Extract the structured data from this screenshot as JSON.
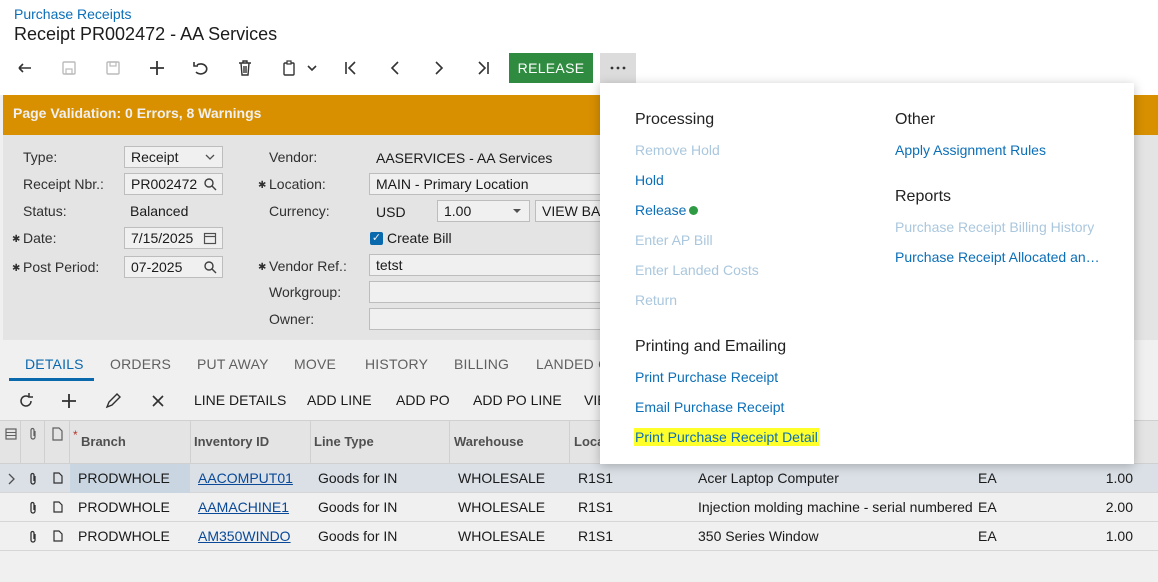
{
  "header": {
    "breadcrumb": "Purchase Receipts",
    "title": "Receipt PR002472 - AA Services"
  },
  "toolbar": {
    "release_label": "RELEASE",
    "more_label": "···"
  },
  "validation": {
    "text": "Page Validation: 0 Errors, 8 Warnings"
  },
  "form": {
    "type_label": "Type:",
    "type_value": "Receipt",
    "receipt_nbr_label": "Receipt Nbr.:",
    "receipt_nbr_value": "PR002472",
    "status_label": "Status:",
    "status_value": "Balanced",
    "date_label": "Date:",
    "date_value": "7/15/2025",
    "post_period_label": "Post Period:",
    "post_period_value": "07-2025",
    "vendor_label": "Vendor:",
    "vendor_value": "AASERVICES - AA Services",
    "location_label": "Location:",
    "location_value": "MAIN - Primary Location",
    "currency_label": "Currency:",
    "currency_value": "USD",
    "currency_rate": "1.00",
    "view_base_label": "VIEW BAS",
    "create_bill_label": "Create Bill",
    "vendor_ref_label": "Vendor Ref.:",
    "vendor_ref_value": "tetst",
    "workgroup_label": "Workgroup:",
    "owner_label": "Owner:"
  },
  "tabs": [
    "DETAILS",
    "ORDERS",
    "PUT AWAY",
    "MOVE",
    "HISTORY",
    "BILLING",
    "LANDED C"
  ],
  "grid_toolbar": [
    "LINE DETAILS",
    "ADD LINE",
    "ADD PO",
    "ADD PO LINE",
    "VIE"
  ],
  "grid": {
    "headers": [
      "Branch",
      "Inventory ID",
      "Line Type",
      "Warehouse",
      "Loca"
    ],
    "rows": [
      {
        "branch": "PRODWHOLE",
        "inventory_id": "AACOMPUT01",
        "line_type": "Goods for IN",
        "warehouse": "WHOLESALE",
        "location": "R1S1",
        "description": "Acer Laptop Computer",
        "uom": "EA",
        "qty": "1.00"
      },
      {
        "branch": "PRODWHOLE",
        "inventory_id": "AAMACHINE1",
        "line_type": "Goods for IN",
        "warehouse": "WHOLESALE",
        "location": "R1S1",
        "description": "Injection molding machine - serial numbered",
        "uom": "EA",
        "qty": "2.00"
      },
      {
        "branch": "PRODWHOLE",
        "inventory_id": "AM350WINDO",
        "line_type": "Goods for IN",
        "warehouse": "WHOLESALE",
        "location": "R1S1",
        "description": "350 Series Window",
        "uom": "EA",
        "qty": "1.00"
      }
    ]
  },
  "menu": {
    "processing": {
      "heading": "Processing",
      "items": [
        "Remove Hold",
        "Hold",
        "Release",
        "Enter AP Bill",
        "Enter Landed Costs",
        "Return"
      ]
    },
    "printing": {
      "heading": "Printing and Emailing",
      "items": [
        "Print Purchase Receipt",
        "Email Purchase Receipt",
        "Print Purchase Receipt Detail"
      ]
    },
    "other": {
      "heading": "Other",
      "items": [
        "Apply Assignment Rules"
      ]
    },
    "reports": {
      "heading": "Reports",
      "items": [
        "Purchase Receipt Billing History",
        "Purchase Receipt Allocated an…"
      ]
    }
  },
  "colors": {
    "accent": "#0b6fb8",
    "release": "#2e8b3f",
    "warning": "#e69a00",
    "highlight": "#ffff2a"
  }
}
